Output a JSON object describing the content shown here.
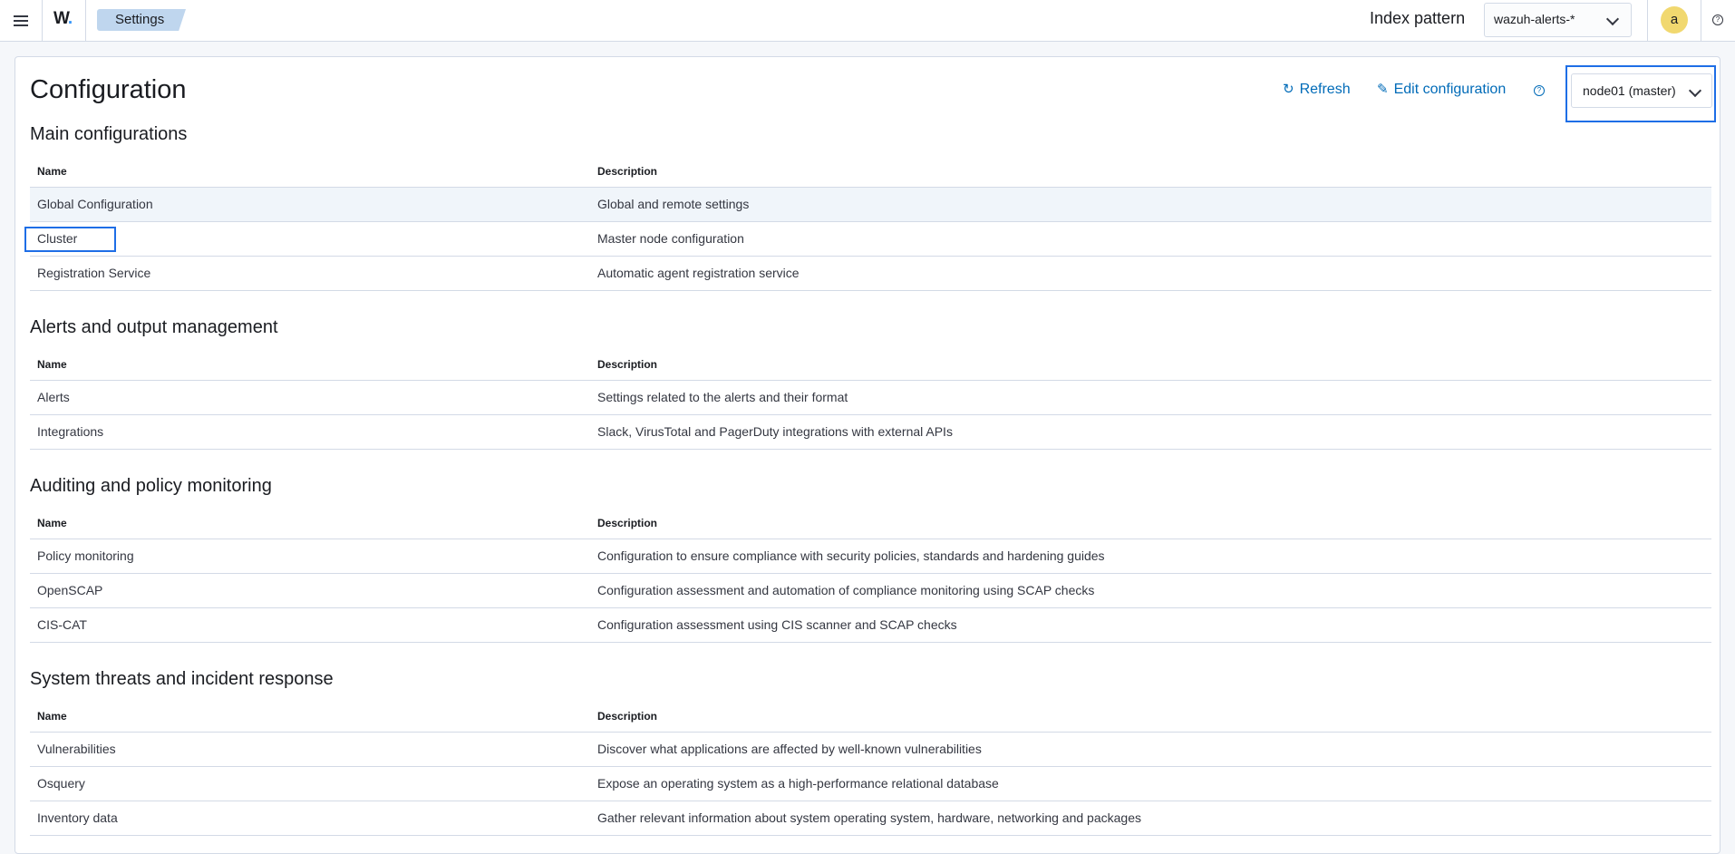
{
  "header": {
    "logo": "W",
    "logo_dot": ".",
    "breadcrumb": "Settings",
    "index_pattern_label": "Index pattern",
    "index_pattern_value": "wazuh-alerts-*",
    "avatar_letter": "a",
    "help_glyph": "?"
  },
  "page": {
    "title": "Configuration",
    "refresh_label": "Refresh",
    "edit_label": "Edit configuration",
    "node_value": "node01 (master)",
    "help_glyph": "?"
  },
  "columns": {
    "name": "Name",
    "description": "Description"
  },
  "sections": [
    {
      "title": "Main configurations",
      "rows": [
        {
          "name": "Global Configuration",
          "description": "Global and remote settings"
        },
        {
          "name": "Cluster",
          "description": "Master node configuration"
        },
        {
          "name": "Registration Service",
          "description": "Automatic agent registration service"
        }
      ]
    },
    {
      "title": "Alerts and output management",
      "rows": [
        {
          "name": "Alerts",
          "description": "Settings related to the alerts and their format"
        },
        {
          "name": "Integrations",
          "description": "Slack, VirusTotal and PagerDuty integrations with external APIs"
        }
      ]
    },
    {
      "title": "Auditing and policy monitoring",
      "rows": [
        {
          "name": "Policy monitoring",
          "description": "Configuration to ensure compliance with security policies, standards and hardening guides"
        },
        {
          "name": "OpenSCAP",
          "description": "Configuration assessment and automation of compliance monitoring using SCAP checks"
        },
        {
          "name": "CIS-CAT",
          "description": "Configuration assessment using CIS scanner and SCAP checks"
        }
      ]
    },
    {
      "title": "System threats and incident response",
      "rows": [
        {
          "name": "Vulnerabilities",
          "description": "Discover what applications are affected by well-known vulnerabilities"
        },
        {
          "name": "Osquery",
          "description": "Expose an operating system as a high-performance relational database"
        },
        {
          "name": "Inventory data",
          "description": "Gather relevant information about system operating system, hardware, networking and packages"
        }
      ]
    }
  ],
  "colors": {
    "link": "#006bb8",
    "focus": "#1e6ee6",
    "avatar": "#f1d86f",
    "breadcrumb": "#bfd6ee"
  }
}
